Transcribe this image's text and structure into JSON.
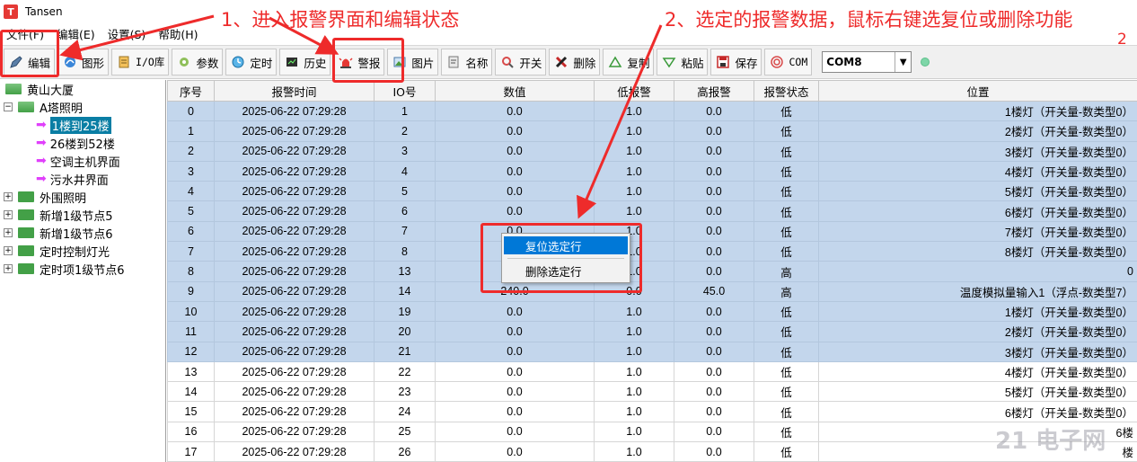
{
  "window": {
    "title": "Tansen",
    "icon_letter": "T"
  },
  "menu": [
    "文件(F)",
    "编辑(E)",
    "设置(S)",
    "帮助(H)"
  ],
  "toolbar": {
    "buttons": [
      {
        "label": "编辑",
        "icon": "edit-icon"
      },
      {
        "label": "图形",
        "icon": "graphics-icon"
      },
      {
        "label": "I/O库",
        "icon": "io-library-icon"
      },
      {
        "label": "参数",
        "icon": "parameters-icon"
      },
      {
        "label": "定时",
        "icon": "timer-icon"
      },
      {
        "label": "历史",
        "icon": "history-icon"
      },
      {
        "label": "警报",
        "icon": "alarm-icon"
      },
      {
        "label": "图片",
        "icon": "image-icon"
      },
      {
        "label": "名称",
        "icon": "name-icon"
      },
      {
        "label": "开关",
        "icon": "switch-icon"
      },
      {
        "label": "删除",
        "icon": "delete-icon"
      },
      {
        "label": "复制",
        "icon": "copy-icon"
      },
      {
        "label": "粘贴",
        "icon": "paste-icon"
      },
      {
        "label": "保存",
        "icon": "save-icon"
      },
      {
        "label": "COM",
        "icon": "com-icon"
      }
    ],
    "port_select": "COM8"
  },
  "tree": {
    "items": [
      {
        "label": "黄山大厦",
        "level": 0,
        "type": "root"
      },
      {
        "label": "A塔照明",
        "level": 1,
        "type": "folder-open",
        "expander": "−"
      },
      {
        "label": "1楼到25楼",
        "level": 2,
        "type": "page",
        "selected": true
      },
      {
        "label": "26楼到52楼",
        "level": 2,
        "type": "page"
      },
      {
        "label": "空调主机界面",
        "level": 2,
        "type": "page"
      },
      {
        "label": "污水井界面",
        "level": 2,
        "type": "page"
      },
      {
        "label": "外围照明",
        "level": 1,
        "type": "folder",
        "expander": "+"
      },
      {
        "label": "新增1级节点5",
        "level": 1,
        "type": "folder",
        "expander": "+"
      },
      {
        "label": "新增1级节点6",
        "level": 1,
        "type": "folder",
        "expander": "+"
      },
      {
        "label": "定时控制灯光",
        "level": 1,
        "type": "folder",
        "expander": "+"
      },
      {
        "label": "定时项1级节点6",
        "level": 1,
        "type": "folder",
        "expander": "+"
      }
    ]
  },
  "table": {
    "columns": [
      "序号",
      "报警时间",
      "IO号",
      "数值",
      "低报警",
      "高报警",
      "报警状态",
      "位置"
    ],
    "rows": [
      {
        "sel": true,
        "cells": [
          "0",
          "2025-06-22 07:29:28",
          "1",
          "0.0",
          "1.0",
          "0.0",
          "低",
          "1楼灯（开关量-数类型0）"
        ]
      },
      {
        "sel": true,
        "cells": [
          "1",
          "2025-06-22 07:29:28",
          "2",
          "0.0",
          "1.0",
          "0.0",
          "低",
          "2楼灯（开关量-数类型0）"
        ]
      },
      {
        "sel": true,
        "cells": [
          "2",
          "2025-06-22 07:29:28",
          "3",
          "0.0",
          "1.0",
          "0.0",
          "低",
          "3楼灯（开关量-数类型0）"
        ]
      },
      {
        "sel": true,
        "cells": [
          "3",
          "2025-06-22 07:29:28",
          "4",
          "0.0",
          "1.0",
          "0.0",
          "低",
          "4楼灯（开关量-数类型0）"
        ]
      },
      {
        "sel": true,
        "cells": [
          "4",
          "2025-06-22 07:29:28",
          "5",
          "0.0",
          "1.0",
          "0.0",
          "低",
          "5楼灯（开关量-数类型0）"
        ]
      },
      {
        "sel": true,
        "cells": [
          "5",
          "2025-06-22 07:29:28",
          "6",
          "0.0",
          "1.0",
          "0.0",
          "低",
          "6楼灯（开关量-数类型0）"
        ]
      },
      {
        "sel": true,
        "cells": [
          "6",
          "2025-06-22 07:29:28",
          "7",
          "0.0",
          "1.0",
          "0.0",
          "低",
          "7楼灯（开关量-数类型0）"
        ]
      },
      {
        "sel": true,
        "cells": [
          "7",
          "2025-06-22 07:29:28",
          "8",
          "0.0",
          "1.0",
          "0.0",
          "低",
          "8楼灯（开关量-数类型0）"
        ]
      },
      {
        "sel": true,
        "cells": [
          "8",
          "2025-06-22 07:29:28",
          "13",
          "89.",
          "1.0",
          "0.0",
          "高",
          "0"
        ]
      },
      {
        "sel": true,
        "cells": [
          "9",
          "2025-06-22 07:29:28",
          "14",
          "240.0",
          "0.0",
          "45.0",
          "高",
          "温度模拟量输入1（浮点-数类型7）"
        ]
      },
      {
        "sel": true,
        "cells": [
          "10",
          "2025-06-22 07:29:28",
          "19",
          "0.0",
          "1.0",
          "0.0",
          "低",
          "1楼灯（开关量-数类型0）"
        ]
      },
      {
        "sel": true,
        "cells": [
          "11",
          "2025-06-22 07:29:28",
          "20",
          "0.0",
          "1.0",
          "0.0",
          "低",
          "2楼灯（开关量-数类型0）"
        ]
      },
      {
        "sel": true,
        "cells": [
          "12",
          "2025-06-22 07:29:28",
          "21",
          "0.0",
          "1.0",
          "0.0",
          "低",
          "3楼灯（开关量-数类型0）"
        ]
      },
      {
        "sel": false,
        "cells": [
          "13",
          "2025-06-22 07:29:28",
          "22",
          "0.0",
          "1.0",
          "0.0",
          "低",
          "4楼灯（开关量-数类型0）"
        ]
      },
      {
        "sel": false,
        "cells": [
          "14",
          "2025-06-22 07:29:28",
          "23",
          "0.0",
          "1.0",
          "0.0",
          "低",
          "5楼灯（开关量-数类型0）"
        ]
      },
      {
        "sel": false,
        "cells": [
          "15",
          "2025-06-22 07:29:28",
          "24",
          "0.0",
          "1.0",
          "0.0",
          "低",
          "6楼灯（开关量-数类型0）"
        ]
      },
      {
        "sel": false,
        "cells": [
          "16",
          "2025-06-22 07:29:28",
          "25",
          "0.0",
          "1.0",
          "0.0",
          "低",
          "6楼"
        ]
      },
      {
        "sel": false,
        "cells": [
          "17",
          "2025-06-22 07:29:28",
          "26",
          "0.0",
          "1.0",
          "0.0",
          "低",
          "楼"
        ]
      }
    ]
  },
  "context_menu": {
    "items": [
      "复位选定行",
      "删除选定行"
    ]
  },
  "annotations": {
    "step1": "1、进入报警界面和编辑状态",
    "step2": "2、选定的报警数据，鼠标右键选复位或删除功能",
    "corner_number": "2",
    "color": "#ee2b2b"
  },
  "watermark": "21 电子网"
}
